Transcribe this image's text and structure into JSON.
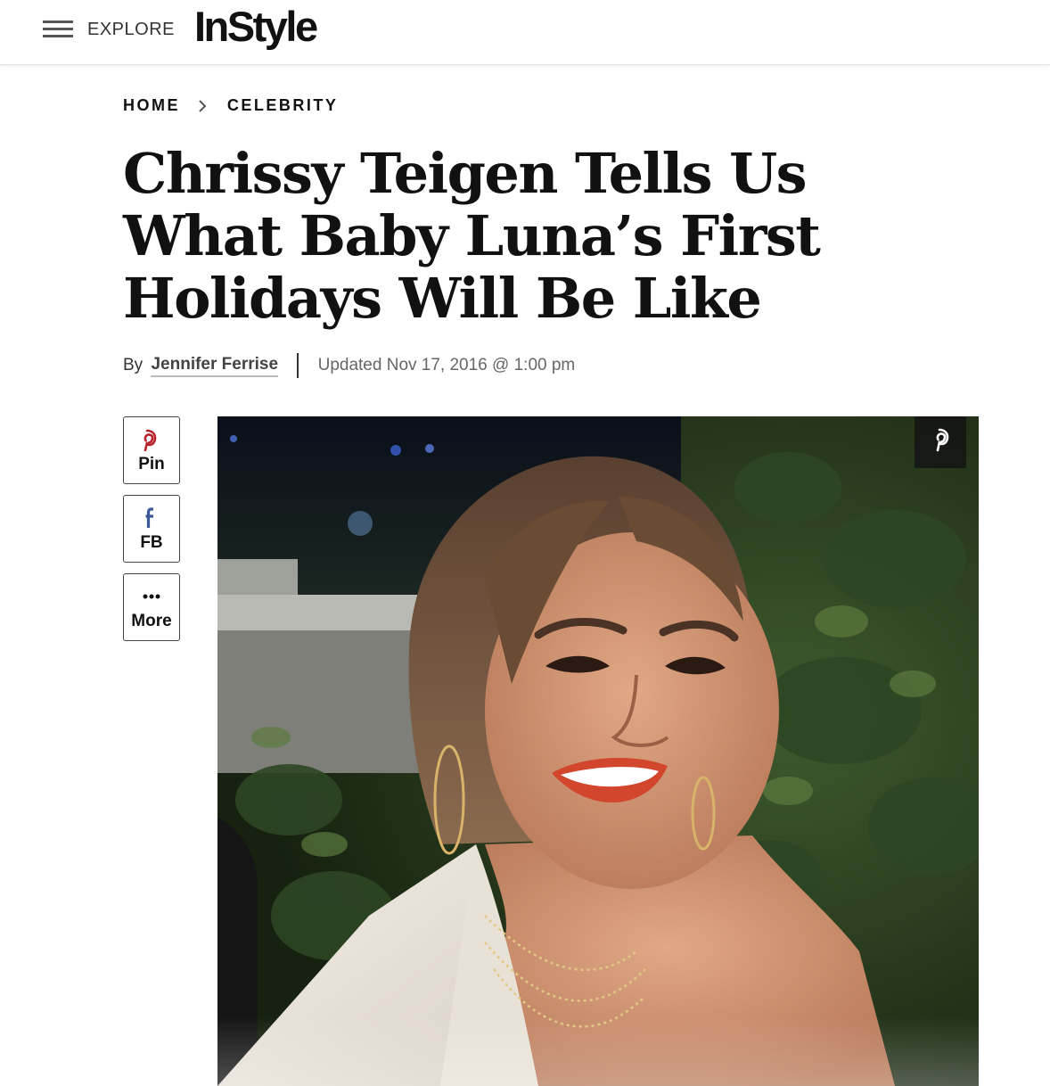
{
  "header": {
    "menu_label": "EXPLORE",
    "logo": "InStyle"
  },
  "breadcrumb": {
    "items": [
      "HOME",
      "CELEBRITY"
    ]
  },
  "article": {
    "headline": "Chrissy Teigen Tells Us What Baby Luna’s First Holidays Will Be Like",
    "by_label": "By",
    "author": "Jennifer Ferrise",
    "updated": "Updated Nov 17, 2016 @ 1:00 pm"
  },
  "share": {
    "pin_label": "Pin",
    "fb_label": "FB",
    "more_label": "More"
  },
  "colors": {
    "pinterest": "#b7212a",
    "facebook": "#3b5998",
    "text": "#111111",
    "muted": "#666666"
  },
  "icons": [
    "hamburger-icon",
    "chevron-right-icon",
    "pinterest-icon",
    "facebook-icon",
    "more-dots-icon"
  ]
}
